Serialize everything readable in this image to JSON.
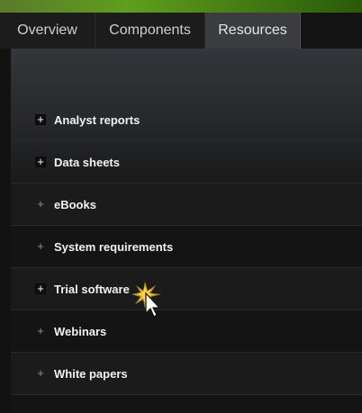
{
  "tabs": [
    {
      "label": "Overview",
      "active": false
    },
    {
      "label": "Components",
      "active": false
    },
    {
      "label": "Resources",
      "active": true
    }
  ],
  "resources": {
    "items": [
      {
        "label": "Analyst reports",
        "icon": "plus-icon"
      },
      {
        "label": "Data sheets",
        "icon": "plus-icon"
      },
      {
        "label": "eBooks",
        "icon": "plus-icon"
      },
      {
        "label": "System requirements",
        "icon": "plus-icon"
      },
      {
        "label": "Trial software",
        "icon": "plus-icon"
      },
      {
        "label": "Webinars",
        "icon": "plus-icon"
      },
      {
        "label": "White papers",
        "icon": "plus-icon"
      }
    ]
  },
  "colors": {
    "accent_banner": "#5f9e1e",
    "active_tab": "#3a3c3f",
    "text": "#f1f1f1"
  }
}
